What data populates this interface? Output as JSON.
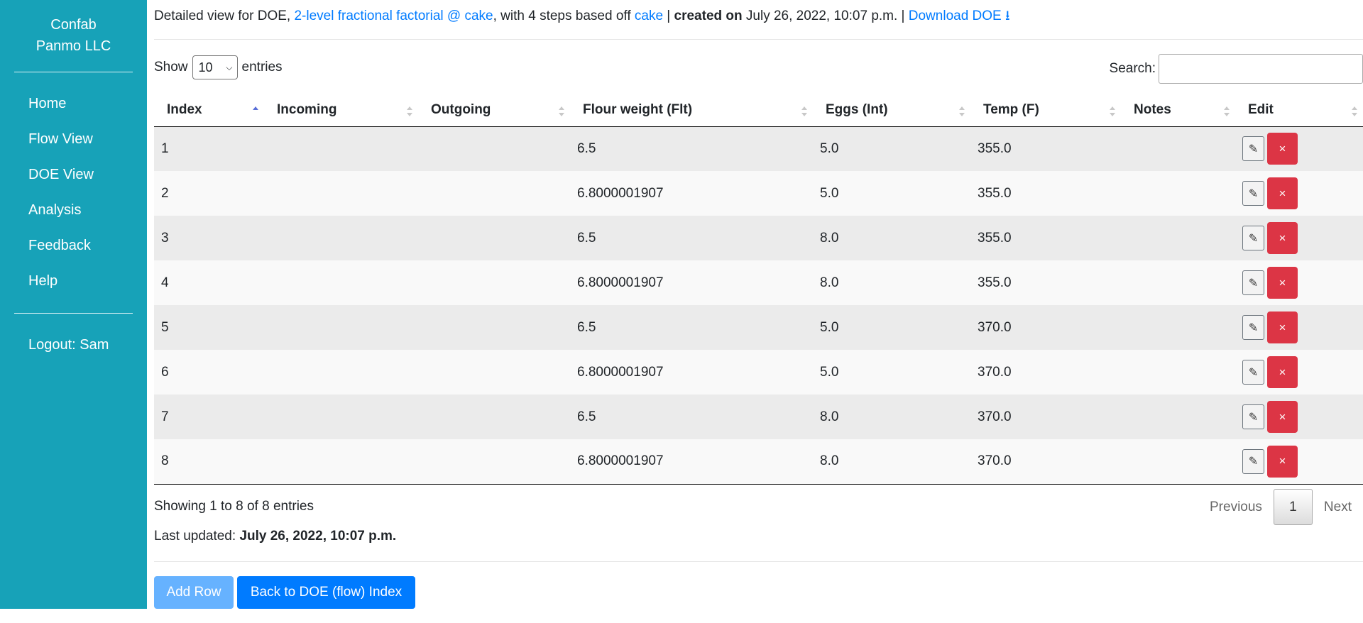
{
  "sidebar": {
    "brand_line1": "Confab",
    "brand_line2": "Panmo LLC",
    "nav": [
      "Home",
      "Flow View",
      "DOE View",
      "Analysis",
      "Feedback",
      "Help"
    ],
    "logout": "Logout: Sam"
  },
  "header": {
    "prefix": "Detailed view for DOE, ",
    "doe_link": "2-level fractional factorial @ cake",
    "middle": ", with 4 steps based off ",
    "flow_link": "cake",
    "sep1": " | ",
    "created_label": "created on",
    "created_value": " July 26, 2022, 10:07 p.m.",
    "sep2": " | ",
    "download_label": "Download DOE",
    "download_icon": "⭳"
  },
  "table_controls": {
    "show_label": "Show",
    "entries_value": "10",
    "entries_label": "entries",
    "search_label": "Search:",
    "search_value": ""
  },
  "table": {
    "columns": [
      "Index",
      "Incoming",
      "Outgoing",
      "Flour weight (Flt)",
      "Eggs (Int)",
      "Temp (F)",
      "Notes",
      "Edit"
    ],
    "rows": [
      [
        "1",
        "",
        "",
        "6.5",
        "5.0",
        "355.0",
        ""
      ],
      [
        "2",
        "",
        "",
        "6.8000001907",
        "5.0",
        "355.0",
        ""
      ],
      [
        "3",
        "",
        "",
        "6.5",
        "8.0",
        "355.0",
        ""
      ],
      [
        "4",
        "",
        "",
        "6.8000001907",
        "8.0",
        "355.0",
        ""
      ],
      [
        "5",
        "",
        "",
        "6.5",
        "5.0",
        "370.0",
        ""
      ],
      [
        "6",
        "",
        "",
        "6.8000001907",
        "5.0",
        "370.0",
        ""
      ],
      [
        "7",
        "",
        "",
        "6.5",
        "8.0",
        "370.0",
        ""
      ],
      [
        "8",
        "",
        "",
        "6.8000001907",
        "8.0",
        "370.0",
        ""
      ]
    ],
    "edit_icon": "✎",
    "delete_icon": "×"
  },
  "footer": {
    "info": "Showing 1 to 8 of 8 entries",
    "previous": "Previous",
    "current_page": "1",
    "next": "Next",
    "updated_label": "Last updated: ",
    "updated_value": "July 26, 2022, 10:07 p.m.",
    "add_row": "Add Row",
    "back": "Back to DOE (flow) Index"
  },
  "colors": {
    "sidebar": "#17a2b8",
    "link": "#007bff",
    "danger": "#dc3545",
    "primary": "#007bff",
    "primary_disabled": "#66b2ff"
  }
}
